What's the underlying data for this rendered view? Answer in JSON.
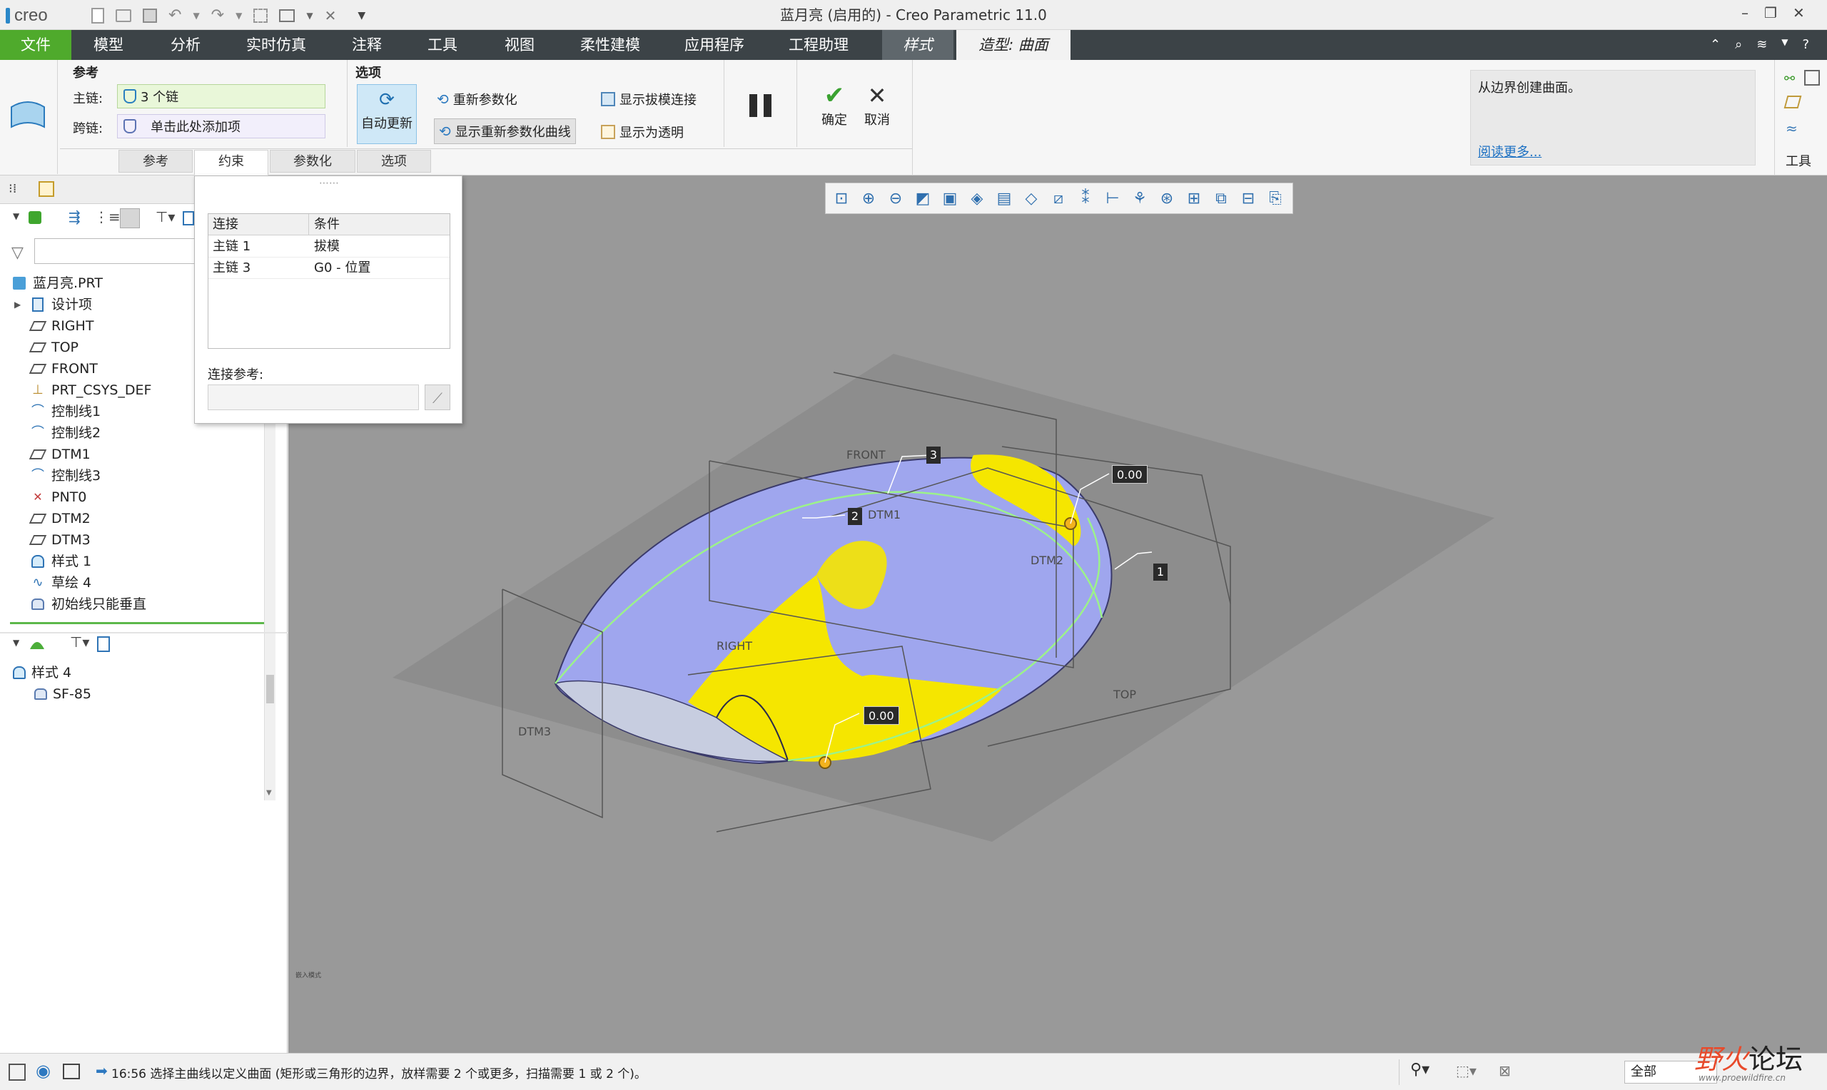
{
  "app": {
    "logo": "creo",
    "window_title": "蓝月亮 (启用的) - Creo Parametric 11.0"
  },
  "menu": {
    "items": [
      "文件",
      "模型",
      "分析",
      "实时仿真",
      "注释",
      "工具",
      "视图",
      "柔性建模",
      "应用程序",
      "工程助理",
      "样式",
      "造型: 曲面"
    ]
  },
  "ribbon": {
    "refs_header": "参考",
    "primary_label": "主链:",
    "primary_value": "3 个链",
    "cross_label": "跨链:",
    "cross_value": "单击此处添加项",
    "options_header": "选项",
    "auto_update": "自动更新",
    "reparam": "重新参数化",
    "show_reparam_curves": "显示重新参数化曲线",
    "show_draft_conn": "显示拔模连接",
    "show_transparent": "显示为透明",
    "confirm": "确定",
    "cancel": "取消",
    "help_text": "从边界创建曲面。",
    "help_link": "阅读更多...",
    "tools_label": "工具",
    "tabs": [
      "参考",
      "约束",
      "参数化",
      "选项"
    ]
  },
  "popup": {
    "col_connect": "连接",
    "col_condition": "条件",
    "rows": [
      {
        "connect": "主链 1",
        "condition": "拔模"
      },
      {
        "connect": "主链 3",
        "condition": "G0 - 位置"
      }
    ],
    "conn_ref_label": "连接参考:"
  },
  "tree": {
    "items": [
      {
        "label": "蓝月亮.PRT",
        "icon": "part-icon"
      },
      {
        "label": "设计项",
        "icon": "design-items-icon"
      },
      {
        "label": "RIGHT",
        "icon": "datum-plane-icon"
      },
      {
        "label": "TOP",
        "icon": "datum-plane-icon"
      },
      {
        "label": "FRONT",
        "icon": "datum-plane-icon"
      },
      {
        "label": "PRT_CSYS_DEF",
        "icon": "csys-icon"
      },
      {
        "label": "控制线1",
        "icon": "curve-icon"
      },
      {
        "label": "控制线2",
        "icon": "curve-icon"
      },
      {
        "label": "DTM1",
        "icon": "datum-plane-icon"
      },
      {
        "label": "控制线3",
        "icon": "curve-icon"
      },
      {
        "label": "PNT0",
        "icon": "datum-point-icon"
      },
      {
        "label": "DTM2",
        "icon": "datum-plane-icon"
      },
      {
        "label": "DTM3",
        "icon": "datum-plane-icon"
      },
      {
        "label": "样式 1",
        "icon": "style-icon"
      },
      {
        "label": "草绘 4",
        "icon": "sketch-icon"
      },
      {
        "label": "初始线只能垂直",
        "icon": "surface-icon"
      }
    ],
    "style_items": [
      {
        "label": "样式 4",
        "icon": "style-icon"
      },
      {
        "label": "SF-85",
        "icon": "surface-icon"
      }
    ]
  },
  "viewport": {
    "labels": {
      "front": "FRONT",
      "right": "RIGHT",
      "top": "TOP",
      "dtm1": "DTM1",
      "dtm2": "DTM2",
      "dtm3": "DTM3"
    },
    "callouts": [
      "3",
      "2",
      "1"
    ],
    "values": [
      "0.00",
      "0.00"
    ],
    "tiny_text": "嵌入模式"
  },
  "status": {
    "message": "16:56 选择主曲线以定义曲面 (矩形或三角形的边界，放样需要 2 个或更多，扫描需要 1 或 2 个)。",
    "filter_value": "全部"
  },
  "watermark": {
    "brand_a": "野火",
    "brand_b": "论坛",
    "url": "www.proewildfire.cn"
  },
  "colors": {
    "menu_bg": "#3c4347",
    "file_tab": "#4faa2c",
    "surface_blue": "#9fa6ee",
    "surface_yellow": "#f5e600"
  }
}
